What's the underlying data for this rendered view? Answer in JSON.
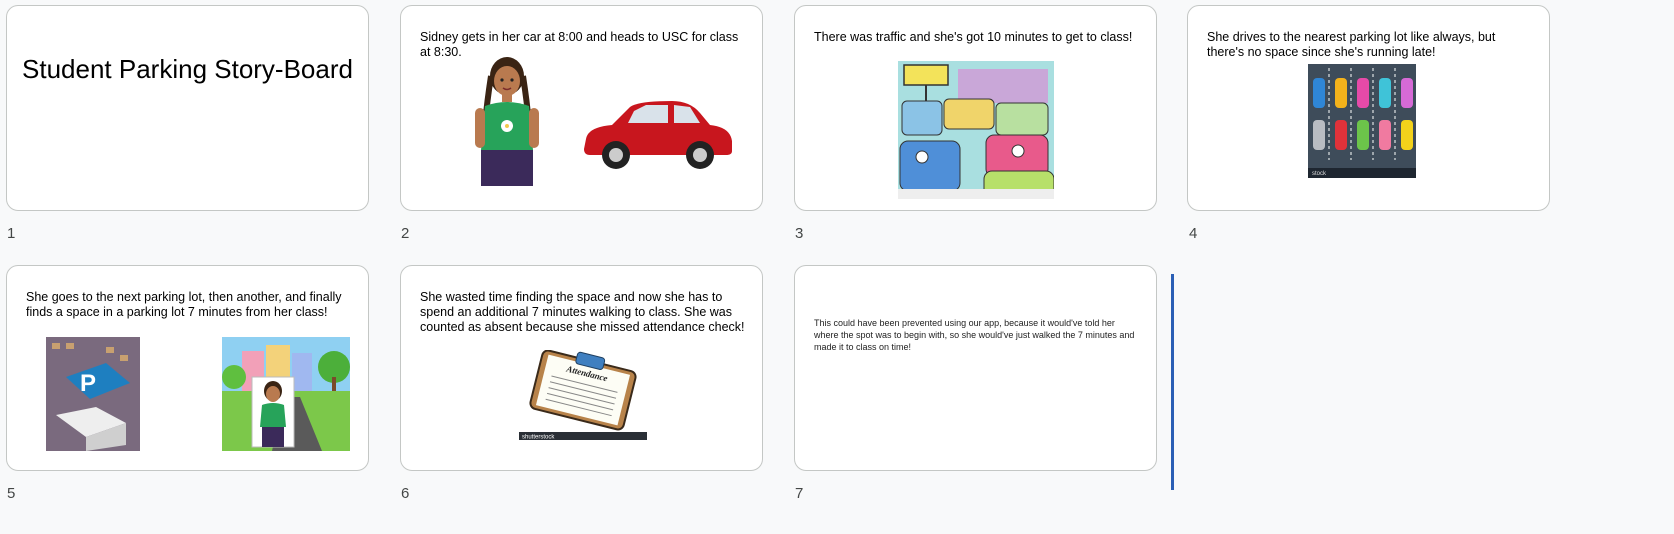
{
  "slides": [
    {
      "number": "1",
      "title": "Student Parking Story-Board"
    },
    {
      "number": "2",
      "text": "Sidney gets in her car at 8:00 and heads to USC for class at 8:30."
    },
    {
      "number": "3",
      "text": "There was traffic and she's got 10 minutes to get to class!"
    },
    {
      "number": "4",
      "text": "She drives to the nearest parking lot like always, but there's no space since she's running late!"
    },
    {
      "number": "5",
      "text": "She goes to the next parking lot, then another, and finally finds a space in a parking lot 7 minutes from her class!"
    },
    {
      "number": "6",
      "text": "She wasted time finding the space and now she has to spend an additional 7 minutes walking to class. She was counted as absent because she missed attendance check!"
    },
    {
      "number": "7",
      "text": "This could have been prevented using our app, because it would've told her where the spot was to begin with, so she would've just walked the 7 minutes and made it to class on time!"
    }
  ],
  "images": {
    "attendance_title": "Attendance",
    "shutterstock": "shutterstock",
    "parking_sign": "P",
    "stock_label": "stock"
  }
}
